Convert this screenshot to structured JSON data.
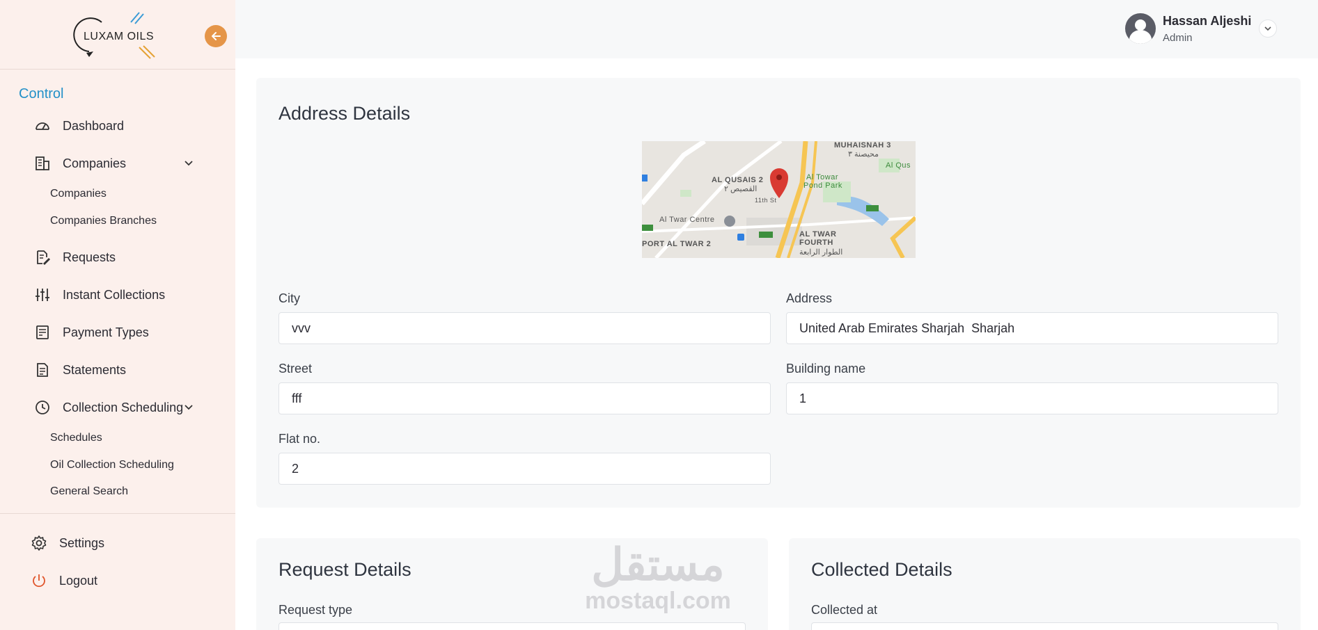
{
  "brand": {
    "logo_text": "LUXAM OILS"
  },
  "sidebar": {
    "section_title": "Control",
    "items": [
      {
        "label": "Dashboard",
        "icon": "dashboard-icon"
      },
      {
        "label": "Companies",
        "icon": "building-icon"
      },
      {
        "label": "Requests",
        "icon": "edit-document-icon"
      },
      {
        "label": "Instant Collections",
        "icon": "sliders-icon"
      },
      {
        "label": "Payment Types",
        "icon": "payment-icon"
      },
      {
        "label": "Statements",
        "icon": "document-icon"
      },
      {
        "label": "Collection Scheduling",
        "icon": "clock-icon"
      }
    ],
    "companies_sub": [
      "Companies",
      "Companies Branches"
    ],
    "scheduling_sub": [
      "Schedules",
      "Oil Collection Scheduling",
      "General Search"
    ],
    "settings_label": "Settings",
    "logout_label": "Logout"
  },
  "header": {
    "user_name": "Hassan Aljeshi",
    "user_role": "Admin"
  },
  "address": {
    "title": "Address Details",
    "map_labels": [
      "MUHAISNAH 3",
      "محيصنة ٣",
      "AL QUSAIS 2",
      "القصيص ٢",
      "Al Towar",
      "Pond Park",
      "Al Qus",
      "Al Twar Centre",
      "AL TWAR",
      "FOURTH",
      "الطوار الرابعة",
      "PORT AL TWAR 2",
      "11th St"
    ],
    "city_label": "City",
    "city_value": "vvv",
    "address_label": "Address",
    "address_value": "United Arab Emirates Sharjah  Sharjah",
    "street_label": "Street",
    "street_value": "fff",
    "building_label": "Building name",
    "building_value": "1",
    "flat_label": "Flat no.",
    "flat_value": "2"
  },
  "request": {
    "title": "Request Details",
    "type_label": "Request type"
  },
  "collected": {
    "title": "Collected Details",
    "at_label": "Collected at"
  },
  "watermark": {
    "arabic": "مستقل",
    "latin": "mostaql.com"
  },
  "colors": {
    "accent": "#2390c8",
    "orange": "#e59548",
    "sidebar_bg": "#fcf0ec",
    "logout": "#e0542a"
  }
}
